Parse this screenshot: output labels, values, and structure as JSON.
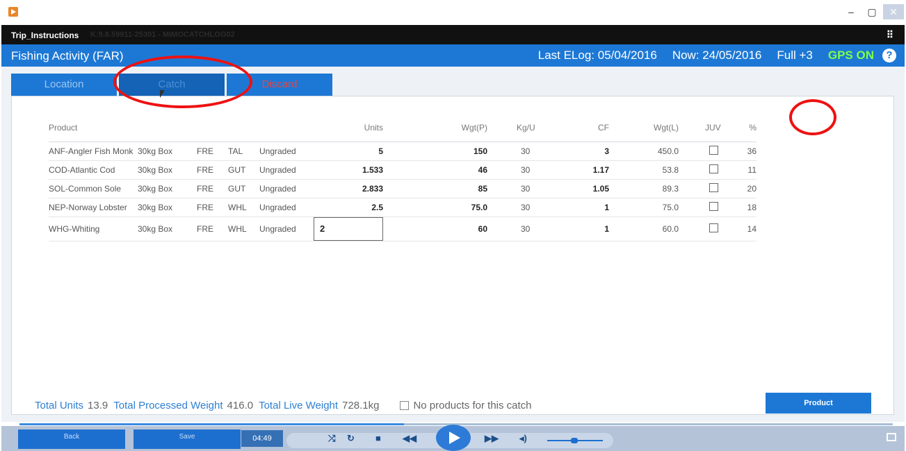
{
  "window": {
    "title": "Trip_Instructions",
    "subtitle_faded": "K:9.8.59911-25301 - MIMOCATCHLOG02",
    "controls": [
      "–",
      "▢",
      "✕"
    ],
    "menu_icon": "⠿"
  },
  "header": {
    "title": "Fishing Activity (FAR)",
    "last_elog": "Last ELog: 05/04/2016",
    "now": "Now: 24/05/2016",
    "full": "Full +3",
    "gps": "GPS ON",
    "help": "?"
  },
  "tabs": [
    {
      "label": "Location"
    },
    {
      "label": "Catch"
    },
    {
      "label": "Discard"
    }
  ],
  "table": {
    "headers": [
      "Product",
      "",
      "",
      "",
      "",
      "Units",
      "Wgt(P)",
      "Kg/U",
      "CF",
      "Wgt(L)",
      "JUV",
      "%"
    ],
    "rows": [
      {
        "product": "ANF-Angler Fish Monk",
        "box": "30kg Box",
        "fresh": "FRE",
        "pres": "TAL",
        "grade": "Ungraded",
        "units": "5",
        "wgtp": "150",
        "kgu": "30",
        "cf": "3",
        "wgtl": "450.0",
        "pct": "36"
      },
      {
        "product": "COD-Atlantic Cod",
        "box": "30kg Box",
        "fresh": "FRE",
        "pres": "GUT",
        "grade": "Ungraded",
        "units": "1.533",
        "wgtp": "46",
        "kgu": "30",
        "cf": "1.17",
        "wgtl": "53.8",
        "pct": "11"
      },
      {
        "product": "SOL-Common Sole",
        "box": "30kg Box",
        "fresh": "FRE",
        "pres": "GUT",
        "grade": "Ungraded",
        "units": "2.833",
        "wgtp": "85",
        "kgu": "30",
        "cf": "1.05",
        "wgtl": "89.3",
        "pct": "20"
      },
      {
        "product": "NEP-Norway Lobster",
        "box": "30kg Box",
        "fresh": "FRE",
        "pres": "WHL",
        "grade": "Ungraded",
        "units": "2.5",
        "wgtp": "75.0",
        "kgu": "30",
        "cf": "1",
        "wgtl": "75.0",
        "pct": "18"
      },
      {
        "product": "WHG-Whiting",
        "box": "30kg Box",
        "fresh": "FRE",
        "pres": "WHL",
        "grade": "Ungraded",
        "units": "2",
        "wgtp": "60",
        "kgu": "30",
        "cf": "1",
        "wgtl": "60.0",
        "pct": "14"
      }
    ]
  },
  "footer": {
    "total_units_label": "Total Units",
    "total_units": "13.9",
    "processed_label": "Total Processed Weight",
    "processed": "416.0",
    "live_label": "Total Live Weight",
    "live": "728.1kg",
    "no_products": "No products for this catch",
    "product_button": "Product"
  },
  "bottom": {
    "back": "Back",
    "save": "Save",
    "time": "04:49",
    "progress_fraction": 0.44
  },
  "colors": {
    "accent": "#1d78d5",
    "gps": "#7dff4a",
    "annotation": "#ee1111",
    "discard": "#e04848"
  }
}
